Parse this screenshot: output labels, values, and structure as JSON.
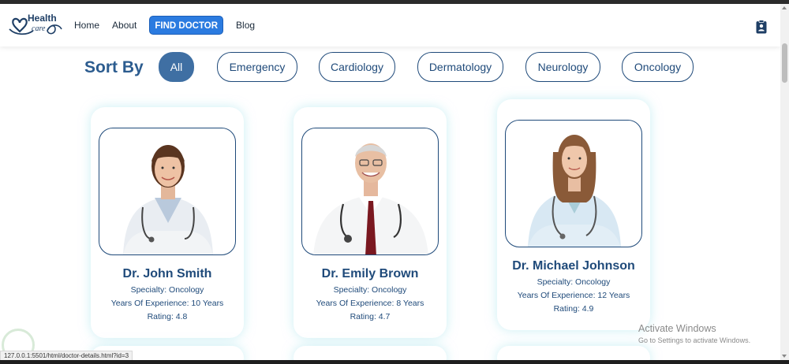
{
  "nav": {
    "logo_top": "Health",
    "logo_bottom": "care",
    "links": [
      "Home",
      "About"
    ],
    "cta": "FIND DOCTOR",
    "blog": "Blog"
  },
  "sort": {
    "title": "Sort By",
    "options": [
      "All",
      "Emergency",
      "Cardiology",
      "Dermatology",
      "Neurology",
      "Oncology"
    ],
    "active": "All"
  },
  "doctors": [
    {
      "name": "Dr. John Smith",
      "specialty": "Specialty: Oncology",
      "experience": "Years Of Experience: 10 Years",
      "rating": "Rating: 4.8"
    },
    {
      "name": "Dr. Emily Brown",
      "specialty": "Specialty: Oncology",
      "experience": "Years Of Experience: 8 Years",
      "rating": "Rating: 4.7"
    },
    {
      "name": "Dr. Michael Johnson",
      "specialty": "Specialty: Oncology",
      "experience": "Years Of Experience: 12 Years",
      "rating": "Rating: 4.9"
    }
  ],
  "status_url": "127.0.0.1:5501/html/doctor-details.html?id=3",
  "windows": {
    "line1": "Activate Windows",
    "line2": "Go to Settings to activate Windows."
  },
  "colors": {
    "primary": "#1f4a7a",
    "accent": "#2b7be0",
    "chip_active": "#3f6fa3"
  },
  "icons": [
    "health-care-logo",
    "profile-clipboard-icon"
  ]
}
